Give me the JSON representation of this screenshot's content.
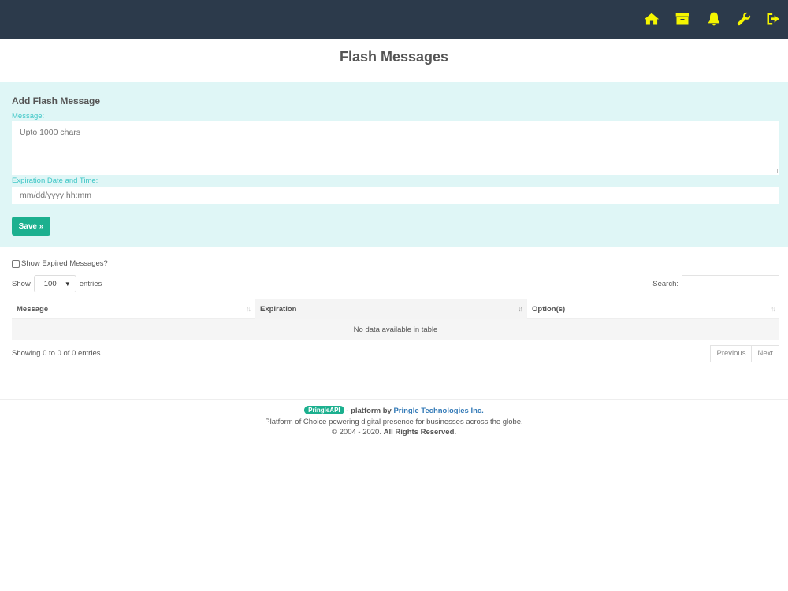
{
  "header": {
    "icons": [
      "home-icon",
      "archive-icon",
      "bell-icon",
      "wrench-icon",
      "sign-out-icon"
    ],
    "icon_color": "#f5f500",
    "bar_color": "#2c3a4b"
  },
  "page": {
    "title": "Flash Messages"
  },
  "form": {
    "title": "Add Flash Message",
    "message_label": "Message:",
    "message_placeholder": "Upto 1000 chars",
    "expiration_label": "Expiration Date and Time:",
    "expiration_placeholder": "mm/dd/yyyy hh:mm",
    "save_label": "Save »",
    "panel_color": "#dff6f6",
    "accent_color": "#1cb08f"
  },
  "filters": {
    "show_expired_label": "Show Expired Messages?",
    "show_expired_checked": false,
    "show_label": "Show",
    "entries_value": "100",
    "entries_label": "entries",
    "search_label": "Search:"
  },
  "table": {
    "columns": [
      "Message",
      "Expiration",
      "Option(s)"
    ],
    "empty_text": "No data available in table"
  },
  "pagination": {
    "info": "Showing 0 to 0 of 0 entries",
    "previous": "Previous",
    "next": "Next"
  },
  "footer": {
    "brand_badge": "PringleAPI",
    "platform_text": "- platform by",
    "company": "Pringle Technologies Inc.",
    "tagline": "Platform of Choice powering digital presence for businesses across the globe.",
    "copyright": "© 2004 - 2020.",
    "rights": "All Rights Reserved."
  }
}
